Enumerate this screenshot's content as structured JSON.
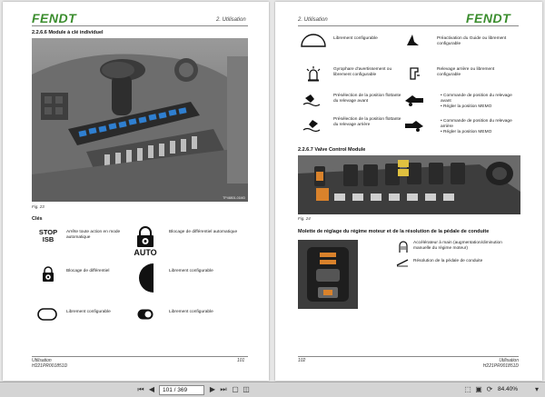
{
  "brand": "FENDT",
  "left_page": {
    "chapter": "2. Utilisation",
    "section_title": "2.2.6.6  Module à clé individuel",
    "photo_code": "TP46801-01MD",
    "figure_caption": "Fig. 23",
    "legend_title": "Clés",
    "keys": [
      {
        "icon": "stop-isb-icon",
        "icon_text_1": "STOP",
        "icon_text_2": "ISB",
        "text": "Arrête toute action en mode automatique"
      },
      {
        "icon": "diff-lock-auto-icon",
        "icon_text_1": "AUTO",
        "text": "Blocage de différentiel automatique"
      },
      {
        "icon": "diff-lock-icon",
        "text": "Blocage de différentiel"
      },
      {
        "icon": "half-circle-icon",
        "text": "Librement configurable"
      },
      {
        "icon": "rounded-rect-icon",
        "text": "Librement configurable"
      },
      {
        "icon": "toggle-icon",
        "text": "Librement configurable"
      }
    ],
    "footer_left_1": "Utilisation",
    "footer_left_2": "H221PR001851D",
    "footer_page": "101"
  },
  "right_page": {
    "chapter": "2. Utilisation",
    "keys": [
      {
        "icon": "dome-icon",
        "text": "Librement configurable"
      },
      {
        "icon": "guidance-icon",
        "text": "Préactivation du Guide ou librement configurable"
      },
      {
        "icon": "beacon-icon",
        "text": "Gyrophare d'avertissement ou librement configurable"
      },
      {
        "icon": "rear-hitch-icon",
        "text": "Relevage arrière ou librement configurable"
      },
      {
        "icon": "front-float-icon",
        "text": "Présélection de la position flottante du relevage avant"
      },
      {
        "icon": "front-hitch-memo-icon",
        "bullets": [
          "Commande de position du relevage avant",
          "Régler la position MEMO"
        ]
      },
      {
        "icon": "rear-float-icon",
        "text": "Présélection de la position flottante du relevage arrière"
      },
      {
        "icon": "rear-hitch-memo-icon",
        "bullets": [
          "Commande de position du relevage arrière",
          "Régler la position MEMO"
        ]
      }
    ],
    "valve_section_title": "2.2.6.7  Valve Control Module",
    "valve_caption": "Fig. 24",
    "engine_section_title": "Molette de réglage du régime moteur et de la résolution de la pédale de conduite",
    "engine_items": [
      {
        "icon": "hand-throttle-icon",
        "text": "Accélérateur à main (augmentation/diminution manuelle du régime moteur)"
      },
      {
        "icon": "pedal-resolution-icon",
        "text": "Résolution de la pédale de conduite"
      }
    ],
    "footer_page": "102",
    "footer_right_1": "Utilisation",
    "footer_right_2": "H221PR001851D"
  },
  "toolbar": {
    "page_value": "101 / 369",
    "zoom_value": "84.40%"
  }
}
